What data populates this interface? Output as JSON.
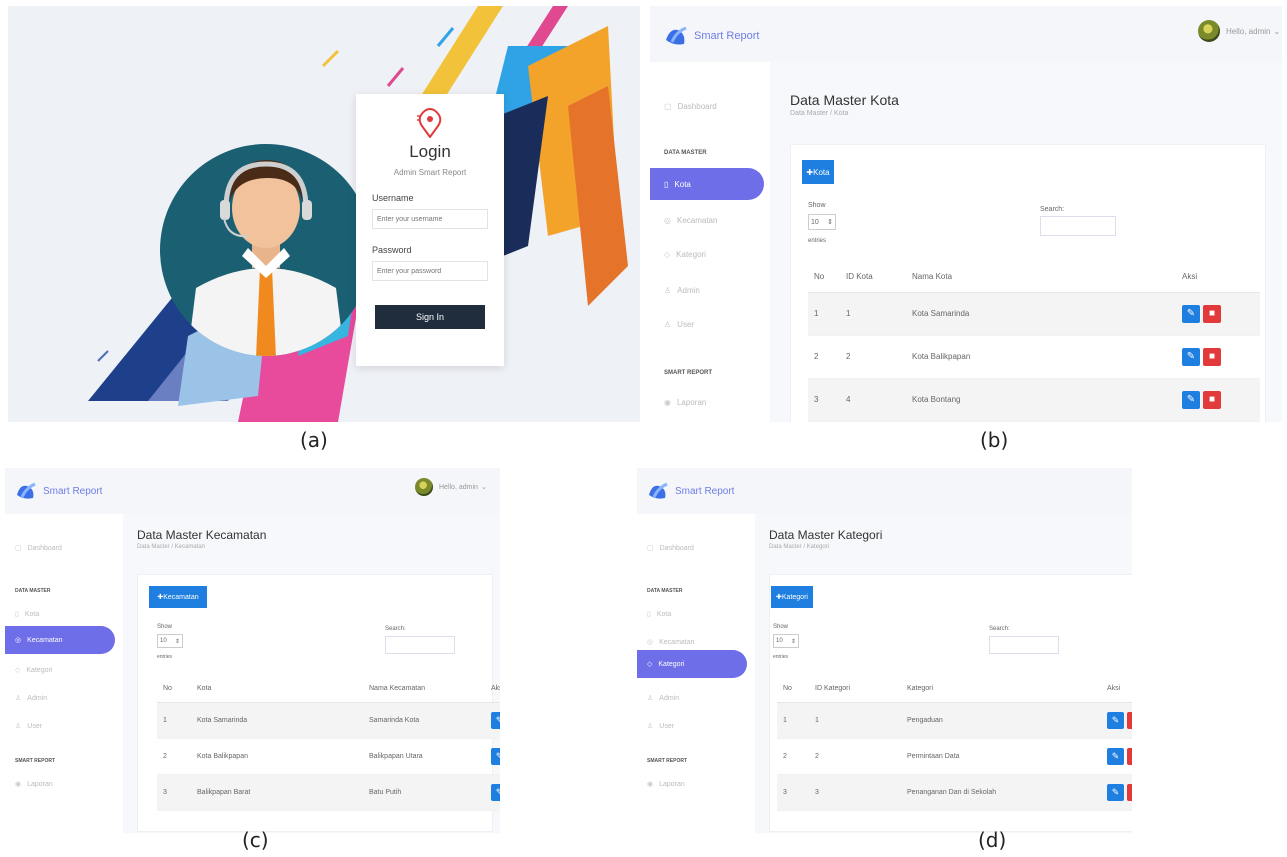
{
  "captions": {
    "a": "(a)",
    "b": "(b)",
    "c": "(c)",
    "d": "(d)"
  },
  "login": {
    "title": "Login",
    "subtitle": "Admin Smart Report",
    "username_label": "Username",
    "username_placeholder": "Enter your username",
    "password_label": "Password",
    "password_placeholder": "Enter your password",
    "signin_label": "Sign In",
    "colors": {
      "accent": "#e23a3a",
      "button": "#1f2d3d",
      "circle": "#1b5f73"
    }
  },
  "app": {
    "brand": "Smart Report",
    "user": "Hello, admin",
    "sidebar": {
      "dashboard": "Dashboard",
      "section_master": "DATA MASTER",
      "kota": "Kota",
      "kecamatan": "Kecamatan",
      "kategori": "Kategori",
      "admin": "Admin",
      "user": "User",
      "section_report": "SMART REPORT",
      "laporan": "Laporan"
    },
    "show_label": "Show",
    "show_value": "10",
    "entries_label": "entries",
    "search_label": "Search:",
    "aksi_label": "Aksi",
    "colors": {
      "primary": "#1e7fe0",
      "danger": "#e23a3a",
      "active_nav": "#6d6ee8"
    }
  },
  "kota": {
    "title": "Data Master Kota",
    "breadcrumb": "Data Master / Kota",
    "add_label": "Kota",
    "headers": [
      "No",
      "ID Kota",
      "Nama Kota",
      "Aksi"
    ],
    "rows": [
      [
        "1",
        "1",
        "Kota Samarinda"
      ],
      [
        "2",
        "2",
        "Kota Balikpapan"
      ],
      [
        "3",
        "4",
        "Kota Bontang"
      ]
    ]
  },
  "kecamatan": {
    "title": "Data Master Kecamatan",
    "breadcrumb": "Data Master / Kecamatan",
    "add_label": "Kecamatan",
    "headers": [
      "No",
      "Kota",
      "Nama Kecamatan",
      "Aksi"
    ],
    "rows": [
      [
        "1",
        "Kota Samarinda",
        "Samarinda Kota"
      ],
      [
        "2",
        "Kota Balikpapan",
        "Balikpapan Utara"
      ],
      [
        "3",
        "Balikpapan Barat",
        "Batu Putih"
      ]
    ]
  },
  "kategori": {
    "title": "Data Master Kategori",
    "breadcrumb": "Data Master / Kategori",
    "add_label": "Kategori",
    "headers": [
      "No",
      "ID Kategori",
      "Kategori",
      "Aksi"
    ],
    "rows": [
      [
        "1",
        "1",
        "Pengaduan"
      ],
      [
        "2",
        "2",
        "Permintaan Data"
      ],
      [
        "3",
        "3",
        "Penanganan Dan di Sekolah"
      ]
    ]
  }
}
